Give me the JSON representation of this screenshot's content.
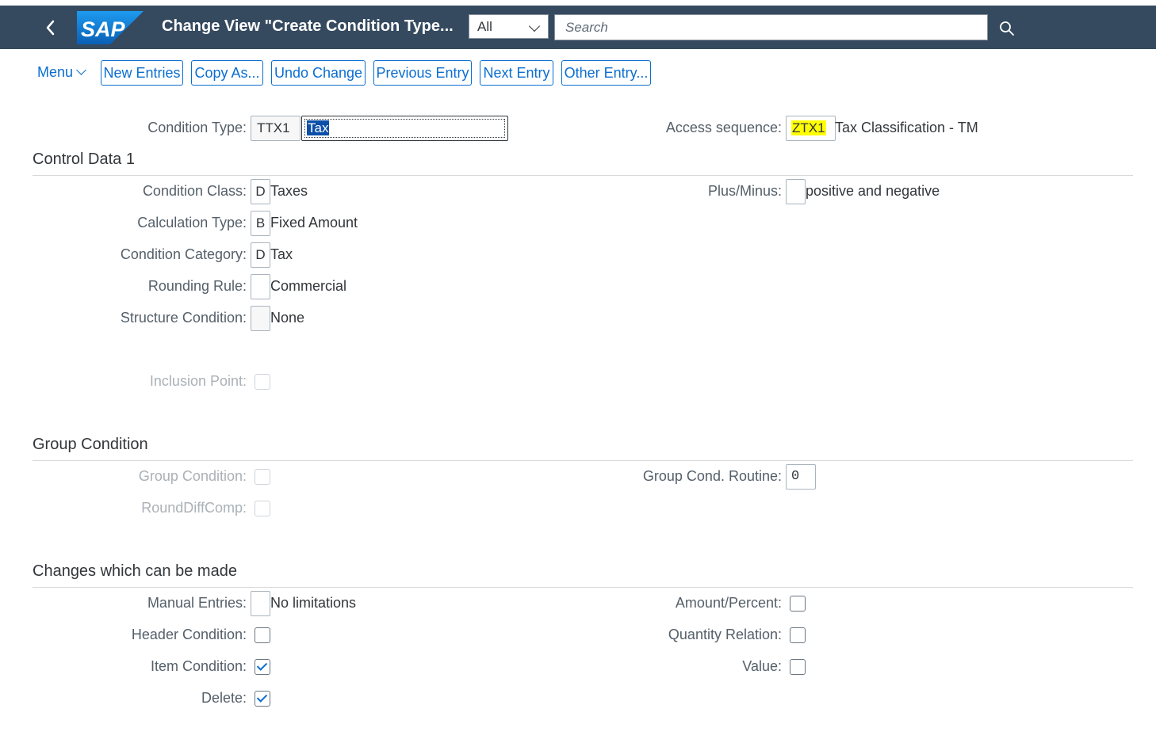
{
  "shell": {
    "title": "Change View \"Create Condition Type...",
    "logo_text": "SAP",
    "scope": "All",
    "search_placeholder": "Search"
  },
  "toolbar": {
    "menu": "Menu",
    "buttons": [
      "New Entries",
      "Copy As...",
      "Undo Change",
      "Previous Entry",
      "Next Entry",
      "Other Entry..."
    ]
  },
  "header": {
    "condition_type_label": "Condition Type:",
    "condition_type_code": "TTX1",
    "condition_type_name": "Tax",
    "access_sequence_label": "Access sequence:",
    "access_sequence_code": "ZTX1",
    "access_sequence_desc": "Tax Classification - TM"
  },
  "control_data": {
    "title": "Control Data 1",
    "condition_class": {
      "label": "Condition Class:",
      "value": "D",
      "desc": "Taxes"
    },
    "calculation_type": {
      "label": "Calculation Type:",
      "value": "B",
      "desc": "Fixed Amount"
    },
    "condition_category": {
      "label": "Condition Category:",
      "value": "D",
      "desc": "Tax"
    },
    "rounding_rule": {
      "label": "Rounding Rule:",
      "value": "",
      "desc": "Commercial"
    },
    "structure_condition": {
      "label": "Structure Condition:",
      "value": "",
      "desc": "None"
    },
    "inclusion_point": {
      "label": "Inclusion Point:",
      "checked": false
    },
    "plus_minus": {
      "label": "Plus/Minus:",
      "value": "",
      "desc": "positive and negative"
    }
  },
  "group_condition": {
    "title": "Group Condition",
    "group_condition": {
      "label": "Group Condition:",
      "checked": false
    },
    "round_diff_comp": {
      "label": "RoundDiffComp:",
      "checked": false
    },
    "group_cond_routine": {
      "label": "Group Cond. Routine:",
      "value": "0"
    }
  },
  "changes": {
    "title": "Changes which can be made",
    "manual_entries": {
      "label": "Manual Entries:",
      "value": "",
      "desc": "No limitations"
    },
    "header_condition": {
      "label": "Header Condition:",
      "checked": false
    },
    "item_condition": {
      "label": "Item Condition:",
      "checked": true
    },
    "delete": {
      "label": "Delete:",
      "checked": true
    },
    "amount_percent": {
      "label": "Amount/Percent:",
      "checked": false
    },
    "quantity_relation": {
      "label": "Quantity Relation:",
      "checked": false
    },
    "value": {
      "label": "Value:",
      "checked": false
    }
  },
  "colors": {
    "shell": "#354a5f",
    "accent": "#0a6ed1",
    "highlight": "#ffff00",
    "selection": "#0b4fa8"
  }
}
